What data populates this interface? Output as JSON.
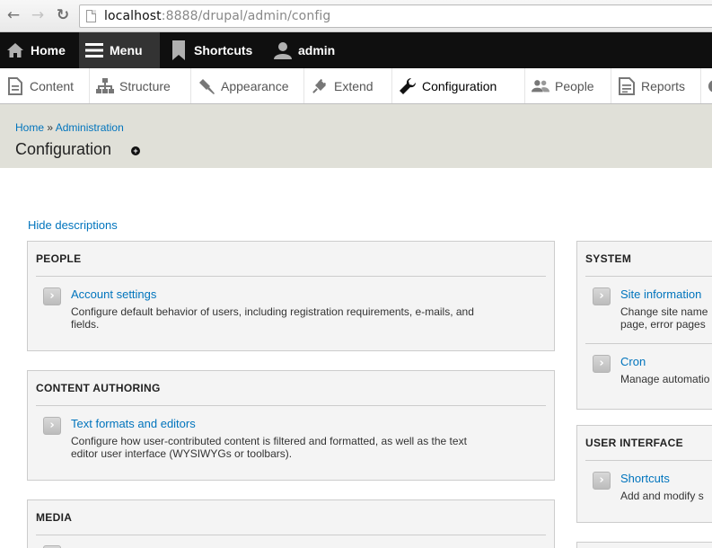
{
  "browser": {
    "back": "←",
    "forward": "→",
    "reload": "↻",
    "url_host": "localhost",
    "url_rest": ":8888/drupal/admin/config"
  },
  "toolbar": {
    "home": "Home",
    "menu": "Menu",
    "shortcuts": "Shortcuts",
    "user": "admin"
  },
  "tray": {
    "content": "Content",
    "structure": "Structure",
    "appearance": "Appearance",
    "extend": "Extend",
    "configuration": "Configuration",
    "people": "People",
    "reports": "Reports"
  },
  "header": {
    "breadcrumb_home": "Home",
    "breadcrumb_sep": "»",
    "breadcrumb_admin": "Administration",
    "title": "Configuration",
    "shortcut_glyph": "+"
  },
  "hide_descriptions": "Hide descriptions",
  "panels": {
    "people": {
      "title": "PEOPLE",
      "entries": [
        {
          "link": "Account settings",
          "desc1": "Configure default behavior of users, including registration requirements, e-mails, and",
          "desc2": "fields."
        }
      ]
    },
    "content_authoring": {
      "title": "CONTENT AUTHORING",
      "entries": [
        {
          "link": "Text formats and editors",
          "desc1": "Configure how user-contributed content is filtered and formatted, as well as the text",
          "desc2": "editor user interface (WYSIWYGs or toolbars)."
        }
      ]
    },
    "media": {
      "title": "MEDIA"
    },
    "system": {
      "title": "SYSTEM",
      "entries": [
        {
          "link": "Site information",
          "desc1": "Change site name",
          "desc2": "page, error pages"
        },
        {
          "link": "Cron",
          "desc1": "Manage automatio"
        }
      ]
    },
    "user_interface": {
      "title": "USER INTERFACE",
      "entries": [
        {
          "link": "Shortcuts",
          "desc1": "Add and modify s"
        }
      ]
    }
  },
  "colors": {
    "link": "#0074bd",
    "toolbar_bg": "#0f0f0f",
    "header_bg": "#e0e0d8",
    "panel_bg": "#f4f4f4"
  }
}
